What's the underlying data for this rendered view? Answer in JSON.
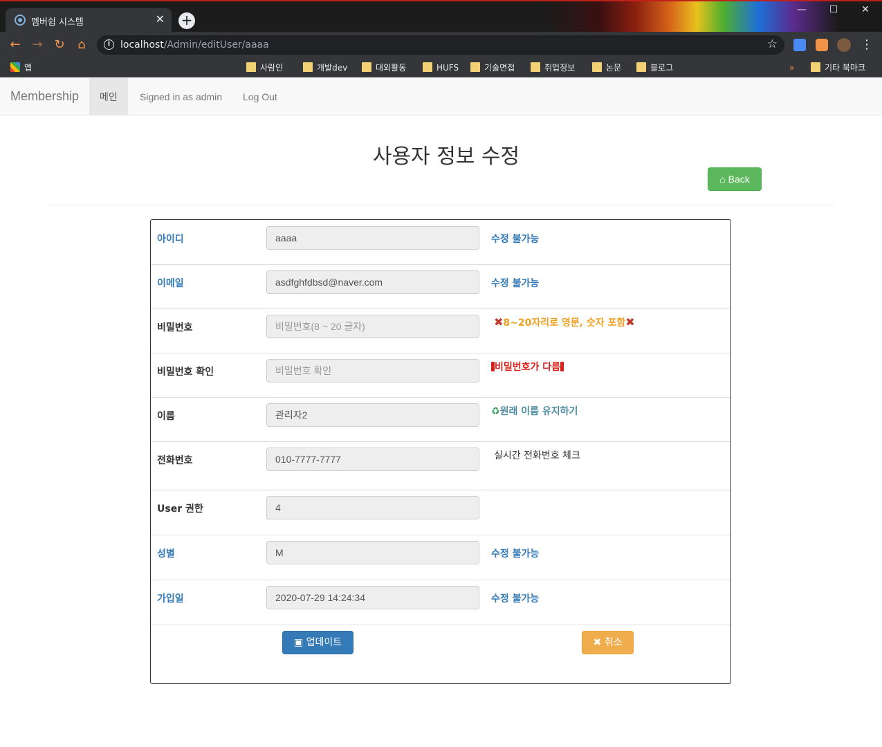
{
  "browser": {
    "tab_title": "멤버쉽 시스템",
    "tab_close": "✕",
    "new_tab": "+",
    "url_host": "localhost",
    "url_path": "/Admin/editUser/aaaa",
    "window_controls": [
      "—",
      "☐",
      "✕"
    ],
    "bookmarks": [
      "앱",
      "사람인",
      "개발dev",
      "대외활동",
      "HUFS",
      "기술면접",
      "취업정보",
      "논문",
      "블로그"
    ],
    "bookmarks_overflow": "»",
    "other_bookmarks": "기타 북마크"
  },
  "navbar": {
    "brand": "Membership",
    "links": [
      "메인",
      "Signed in as admin",
      "Log Out"
    ]
  },
  "page": {
    "title": "사용자 정보 수정",
    "back_label": "Back"
  },
  "form": {
    "rows": [
      {
        "label": "아이디",
        "value": "aaaa",
        "note": "수정 불가능"
      },
      {
        "label": "이메일",
        "value": "asdfghfdbsd@naver.com",
        "note": "수정 불가능"
      },
      {
        "label": "비밀번호",
        "placeholder": "비밀번호(8 ~ 20 글자)",
        "note": "8~20자리로 영문, 숫자 포함"
      },
      {
        "label": "비밀번호 확인",
        "placeholder": "비밀번호 확인",
        "note": "비밀번호가 다름"
      },
      {
        "label": "이름",
        "value": "관리자2",
        "note": "원래 이름 유지하기"
      },
      {
        "label": "전화번호",
        "value": "010-7777-7777",
        "note": "실시간 전화번호 체크"
      },
      {
        "label": "User 권한",
        "value": "4",
        "note": ""
      },
      {
        "label": "성별",
        "value": "M",
        "note": "수정 불가능"
      },
      {
        "label": "가입일",
        "value": "2020-07-29 14:24:34",
        "note": "수정 불가능"
      }
    ],
    "update_label": "업데이트",
    "cancel_label": "취소"
  },
  "colors": {
    "primary": "#337ab7",
    "success": "#5cb85c",
    "warning": "#f0ad4e",
    "error": "#d9201b"
  }
}
